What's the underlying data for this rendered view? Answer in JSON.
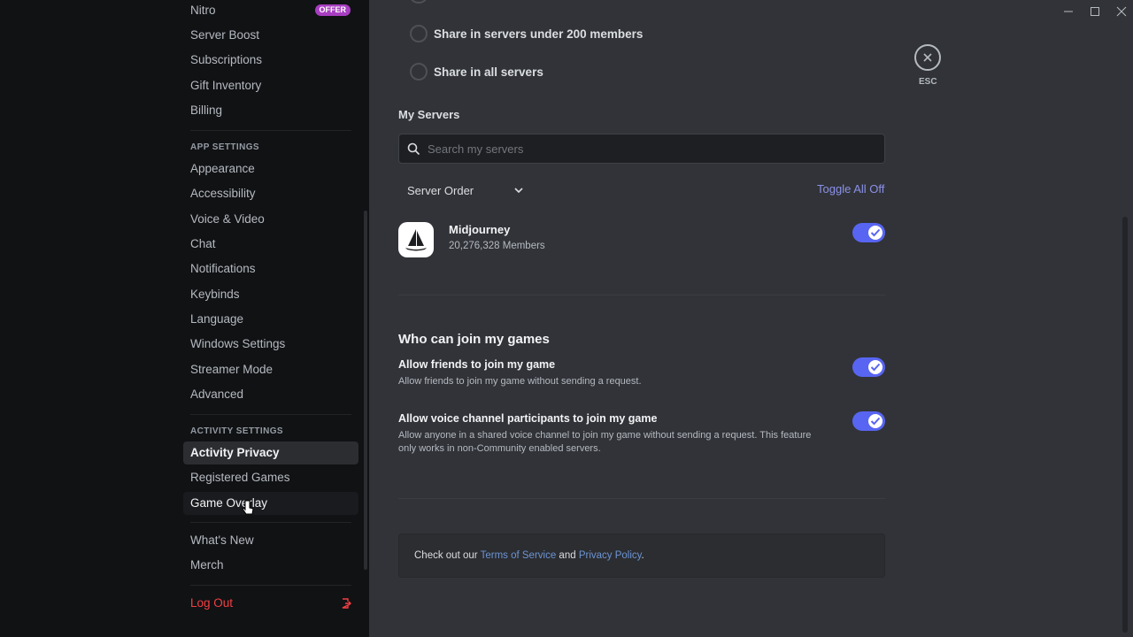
{
  "sidebar": {
    "billing_section": [
      {
        "label": "Nitro",
        "badge": "OFFER"
      },
      {
        "label": "Server Boost"
      },
      {
        "label": "Subscriptions"
      },
      {
        "label": "Gift Inventory"
      },
      {
        "label": "Billing"
      }
    ],
    "app_settings_header": "APP SETTINGS",
    "app_settings": [
      "Appearance",
      "Accessibility",
      "Voice & Video",
      "Chat",
      "Notifications",
      "Keybinds",
      "Language",
      "Windows Settings",
      "Streamer Mode",
      "Advanced"
    ],
    "activity_settings_header": "ACTIVITY SETTINGS",
    "activity_settings": [
      {
        "label": "Activity Privacy",
        "state": "active"
      },
      {
        "label": "Registered Games"
      },
      {
        "label": "Game Overlay",
        "state": "hover"
      }
    ],
    "misc": [
      "What's New",
      "Merch"
    ],
    "logout": "Log Out"
  },
  "content": {
    "radio_options": [
      "Share in servers under 200 members",
      "Share in all servers"
    ],
    "my_servers_title": "My Servers",
    "search_placeholder": "Search my servers",
    "server_order": "Server Order",
    "toggle_all": "Toggle All Off",
    "servers": [
      {
        "name": "Midjourney",
        "members": "20,276,328 Members",
        "enabled": true
      }
    ],
    "join_heading": "Who can join my games",
    "join_options": [
      {
        "title": "Allow friends to join my game",
        "desc": "Allow friends to join my game without sending a request.",
        "enabled": true
      },
      {
        "title": "Allow voice channel participants to join my game",
        "desc": "Allow anyone in a shared voice channel to join my game without sending a request. This feature only works in non-Community enabled servers.",
        "enabled": true
      }
    ],
    "tos": {
      "prefix": "Check out our ",
      "terms": "Terms of Service",
      "and": " and ",
      "privacy": "Privacy Policy",
      "suffix": "."
    },
    "esc_label": "ESC"
  },
  "colors": {
    "accent": "#5865f2",
    "sidebar_bg": "#111214",
    "content_bg": "#313338",
    "badge": "#a83ec1",
    "danger": "#f23f43",
    "link": "#6d94d3"
  }
}
